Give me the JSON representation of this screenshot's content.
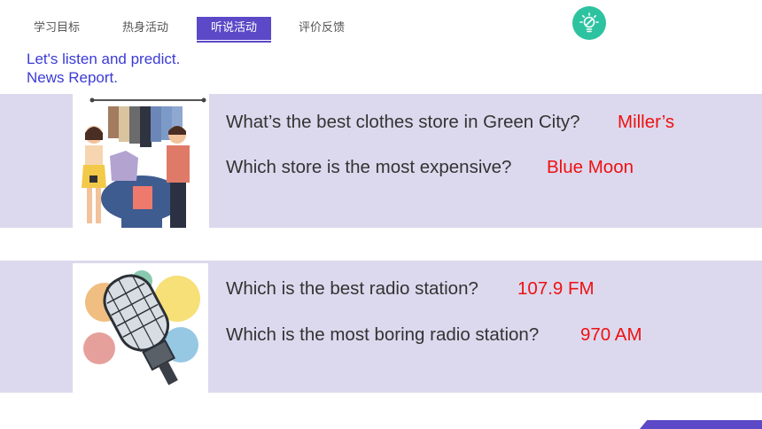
{
  "nav": {
    "tabs": [
      {
        "label": "学习目标"
      },
      {
        "label": "热身活动"
      },
      {
        "label": "听说活动",
        "active": true
      },
      {
        "label": "评价反馈"
      }
    ],
    "bulb_icon": "lightbulb-icon"
  },
  "intro": {
    "line1": "Let's listen and predict.",
    "line2": "News Report."
  },
  "sections": [
    {
      "image": "clothes-store-illustration",
      "questions": [
        {
          "q": "What’s the best clothes store in Green City?",
          "a": "Miller’s"
        },
        {
          "q": "Which store is the most expensive?",
          "a": "Blue Moon"
        }
      ]
    },
    {
      "image": "microphone-illustration",
      "questions": [
        {
          "q": "Which is the best radio station?",
          "a": "107.9 FM"
        },
        {
          "q": "Which is the most boring radio station?",
          "a": "970 AM"
        }
      ]
    }
  ],
  "colors": {
    "accent": "#5b49c7",
    "answer": "#ee1111",
    "band": "#dcd9ee",
    "bulb": "#2dc3a0",
    "intro_text": "#3b3bd6"
  }
}
